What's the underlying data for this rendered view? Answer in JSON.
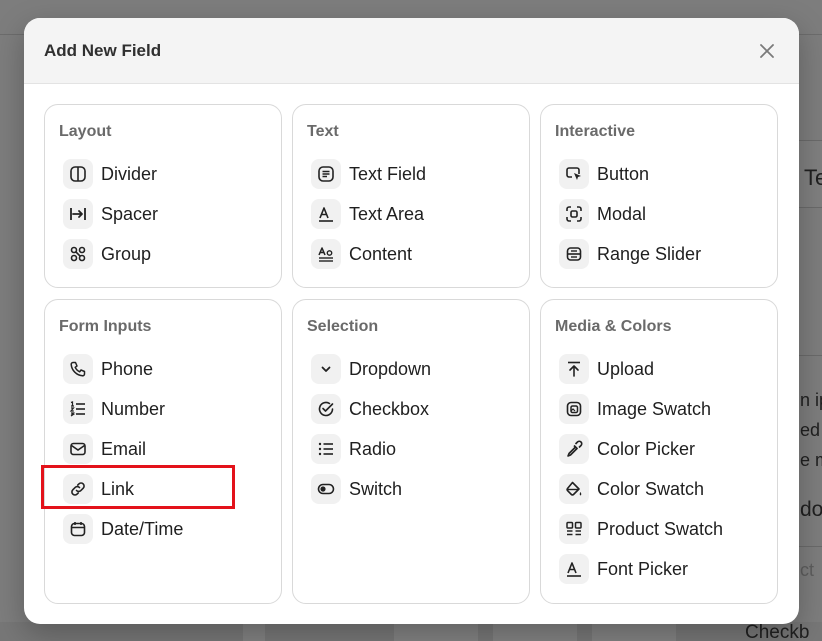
{
  "modal": {
    "title": "Add New Field",
    "close_label": "×"
  },
  "background": {
    "fragments": [
      "Te",
      "n ip",
      "ed",
      "e m",
      "do",
      "ct",
      "Checkb"
    ]
  },
  "sections": [
    {
      "title": "Layout",
      "items": [
        {
          "label": "Divider",
          "icon": "divider-icon"
        },
        {
          "label": "Spacer",
          "icon": "spacer-icon"
        },
        {
          "label": "Group",
          "icon": "group-icon"
        }
      ]
    },
    {
      "title": "Text",
      "items": [
        {
          "label": "Text Field",
          "icon": "text-field-icon"
        },
        {
          "label": "Text Area",
          "icon": "text-area-icon"
        },
        {
          "label": "Content",
          "icon": "content-icon"
        }
      ]
    },
    {
      "title": "Interactive",
      "items": [
        {
          "label": "Button",
          "icon": "button-cursor-icon"
        },
        {
          "label": "Modal",
          "icon": "modal-icon"
        },
        {
          "label": "Range Slider",
          "icon": "range-slider-icon"
        }
      ]
    },
    {
      "title": "Form Inputs",
      "items": [
        {
          "label": "Phone",
          "icon": "phone-icon"
        },
        {
          "label": "Number",
          "icon": "number-list-icon"
        },
        {
          "label": "Email",
          "icon": "email-icon"
        },
        {
          "label": "Link",
          "icon": "link-icon"
        },
        {
          "label": "Date/Time",
          "icon": "calendar-icon"
        }
      ]
    },
    {
      "title": "Selection",
      "items": [
        {
          "label": "Dropdown",
          "icon": "chevron-down-icon"
        },
        {
          "label": "Checkbox",
          "icon": "check-circle-icon"
        },
        {
          "label": "Radio",
          "icon": "list-icon"
        },
        {
          "label": "Switch",
          "icon": "toggle-icon"
        }
      ]
    },
    {
      "title": "Media & Colors",
      "items": [
        {
          "label": "Upload",
          "icon": "upload-icon"
        },
        {
          "label": "Image Swatch",
          "icon": "image-swatch-icon"
        },
        {
          "label": "Color Picker",
          "icon": "eyedropper-icon"
        },
        {
          "label": "Color Swatch",
          "icon": "paint-bucket-icon"
        },
        {
          "label": "Product Swatch",
          "icon": "product-grid-icon"
        },
        {
          "label": "Font Picker",
          "icon": "font-icon"
        }
      ]
    }
  ],
  "colors": {
    "highlight": "#e3121a",
    "overlay": "#7b7b7b",
    "header_bg": "#f4f4f4"
  }
}
